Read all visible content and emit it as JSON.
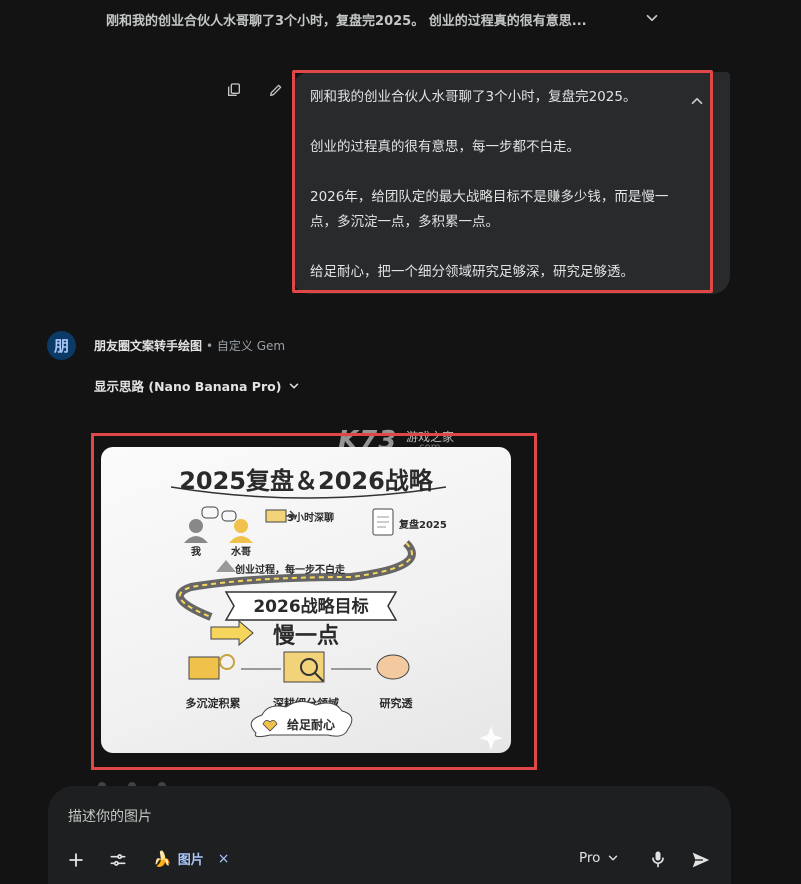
{
  "conversation": {
    "title": "刚和我的创业合伙人水哥聊了3个小时，复盘完2025。 创业的过程真的很有意思..."
  },
  "user_message": {
    "paragraphs": [
      "刚和我的创业合伙人水哥聊了3个小时，复盘完2025。",
      "创业的过程真的很有意思，每一步都不白走。",
      "2026年，给团队定的最大战略目标不是赚多少钱，而是慢一点，多沉淀一点，多积累一点。",
      "给足耐心，把一个细分领域研究足够深，研究足够透。"
    ]
  },
  "response": {
    "avatar_letter": "朋",
    "gem_name": "朋友圈文案转手绘图",
    "gem_type": "• 自定义 Gem",
    "thinking_label": "显示思路 (Nano Banana Pro)",
    "watermark": {
      "brand": "K73",
      "site_name": "游戏之家",
      "suffix": ".com"
    },
    "image": {
      "title": "2025复盘＆2026战略",
      "me": "我",
      "partner": "水哥",
      "talk": "3小时深聊",
      "review": "复盘2025",
      "process": "创业过程，每一步不白走",
      "goal": "2026战略目标",
      "slow": "慢一点",
      "left": "多沉淀积累",
      "middle": "深耕细分领域",
      "right": "研究透",
      "bottom": "给足耐心"
    }
  },
  "composer": {
    "placeholder": "描述你的图片",
    "chip_label": "图片",
    "chip_close": "×",
    "model": "Pro"
  },
  "colors": {
    "highlight": "#e04848",
    "accent": "#a8c7fa",
    "background": "#131314"
  },
  "icons": [
    "chevron-down-icon",
    "copy-icon",
    "edit-icon",
    "chevron-up-icon",
    "plus-icon",
    "tools-icon",
    "banana-icon",
    "mic-icon",
    "send-icon"
  ]
}
